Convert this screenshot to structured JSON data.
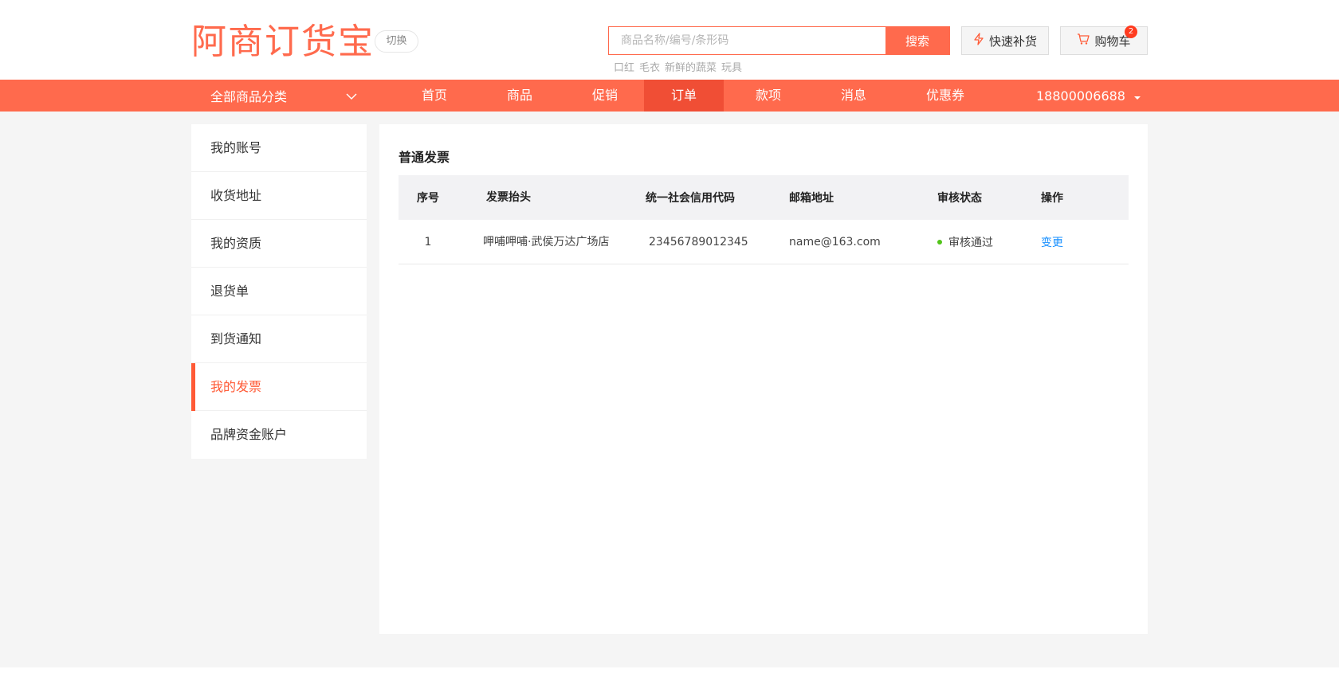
{
  "header": {
    "logo_text": "阿商订货宝",
    "switch_label": "切换",
    "search": {
      "placeholder": "商品名称/编号/条形码",
      "button_label": "搜索"
    },
    "hot_words": [
      "口红",
      "毛衣",
      "新鲜的蔬菜",
      "玩具"
    ],
    "quick_restock_label": "快速补货",
    "cart_label": "购物车",
    "cart_count": "2"
  },
  "nav": {
    "category_label": "全部商品分类",
    "items": [
      {
        "label": "首页"
      },
      {
        "label": "商品"
      },
      {
        "label": "促销"
      },
      {
        "label": "订单",
        "active": true
      },
      {
        "label": "款项"
      },
      {
        "label": "消息"
      },
      {
        "label": "优惠券"
      }
    ],
    "user_phone": "18800006688"
  },
  "sidebar": {
    "items": [
      {
        "label": "我的账号"
      },
      {
        "label": "收货地址"
      },
      {
        "label": "我的资质"
      },
      {
        "label": "退货单"
      },
      {
        "label": "到货通知"
      },
      {
        "label": "我的发票",
        "active": true
      },
      {
        "label": "品牌资金账户"
      }
    ]
  },
  "main": {
    "title": "普通发票",
    "table": {
      "headers": [
        "序号",
        "发票抬头",
        "统一社会信用代码",
        "邮箱地址",
        "审核状态",
        "操作"
      ],
      "rows": [
        {
          "index": "1",
          "invoice_title": "呷哺呷哺·武侯万达广场店",
          "credit_code": "23456789012345",
          "email": "name@163.com",
          "status": "审核通过",
          "action": "变更"
        }
      ]
    }
  },
  "colors": {
    "brand": "#ff6a4d",
    "nav_active": "#f04e35",
    "status_ok": "#52c41a",
    "link": "#1890ff"
  }
}
